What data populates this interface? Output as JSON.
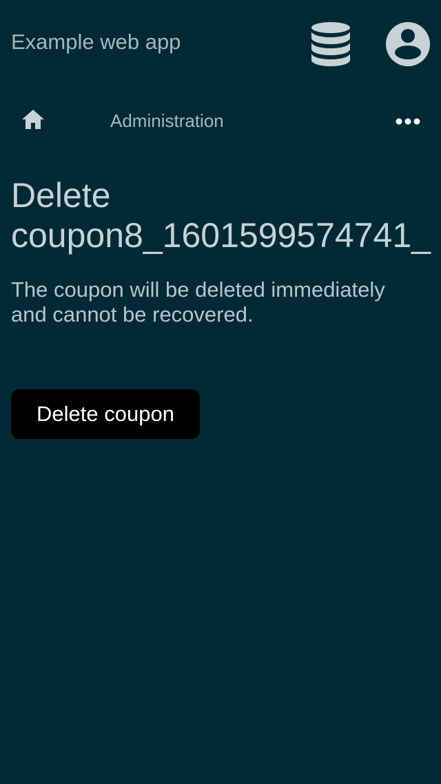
{
  "header": {
    "app_title": "Example web app",
    "icons": {
      "database": "database-icon",
      "account": "account-circle-icon"
    }
  },
  "nav": {
    "home_icon": "home-icon",
    "admin_label": "Administration",
    "more_icon": "more-horizontal-icon"
  },
  "main": {
    "title_line1": "Delete",
    "title_line2": "coupon8_1601599574741_",
    "description": "The coupon will be deleted immediately and cannot be recovered.",
    "delete_button_label": "Delete coupon"
  },
  "colors": {
    "background": "#012a36",
    "text": "#c6d2d6",
    "muted_text": "#a6b6bb",
    "button_bg": "#000000",
    "button_text": "#ffffff"
  }
}
